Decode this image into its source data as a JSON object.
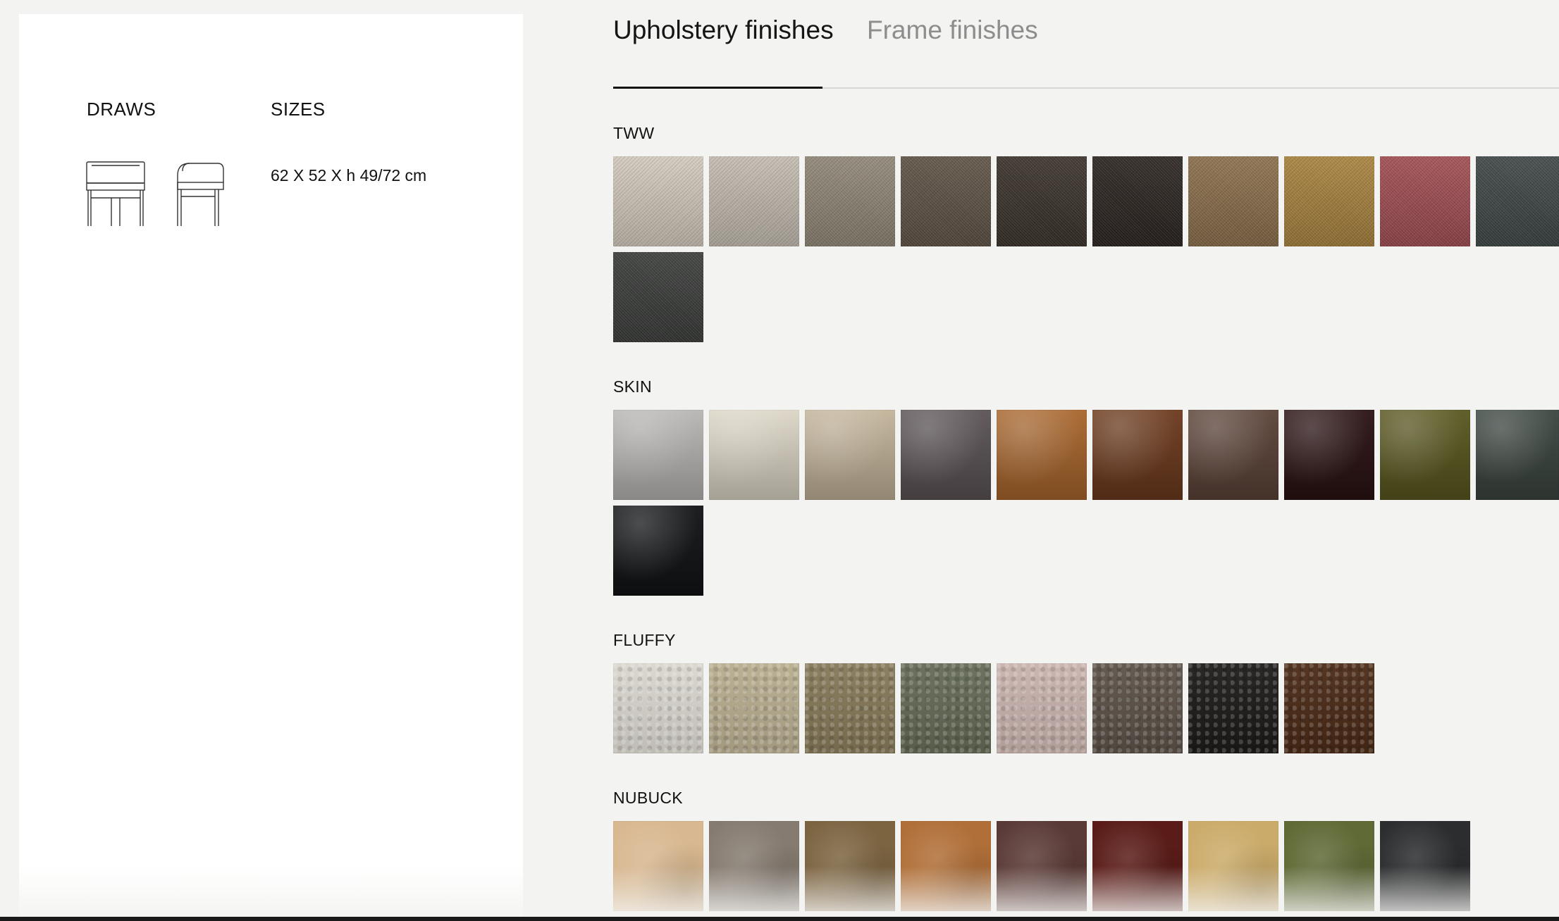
{
  "left_panel": {
    "draws_label": "DRAWS",
    "sizes_label": "SIZES",
    "sizes_value": "62 X 52 X h 49/72 cm"
  },
  "tabs": [
    {
      "label": "Upholstery finishes",
      "active": true
    },
    {
      "label": "Frame finishes",
      "active": false
    }
  ],
  "sections": [
    {
      "title": "TWW",
      "texture": "fabric",
      "swatches": [
        "#d2c9bc",
        "#c3bbb0",
        "#8f8676",
        "#5e5245",
        "#3a322a",
        "#2b2420",
        "#8a6e4b",
        "#a8823e",
        "#a04d52",
        "#3e4746",
        "#3a3c3a"
      ]
    },
    {
      "title": "SKIN",
      "texture": "leather",
      "swatches": [
        "#b8b6b4",
        "#dcd6c6",
        "#c3b49a",
        "#5b5355",
        "#a8662d",
        "#6c3a1d",
        "#5b4338",
        "#2a1213",
        "#59571f",
        "#3b4540",
        "#111315"
      ]
    },
    {
      "title": "FLUFFY",
      "texture": "fluffy",
      "swatches": [
        "#d9d6ce",
        "#b7ad8f",
        "#857858",
        "#636a55",
        "#c8b2ad",
        "#5b5148",
        "#1d1b19",
        "#4a2a16"
      ]
    },
    {
      "title": "NUBUCK",
      "texture": "nubuck",
      "swatches": [
        "#d8b890",
        "#857b70",
        "#7c6441",
        "#b06f38",
        "#5a3a36",
        "#5a1c18",
        "#cbab6a",
        "#5f6a36",
        "#2b2d2e"
      ]
    }
  ]
}
